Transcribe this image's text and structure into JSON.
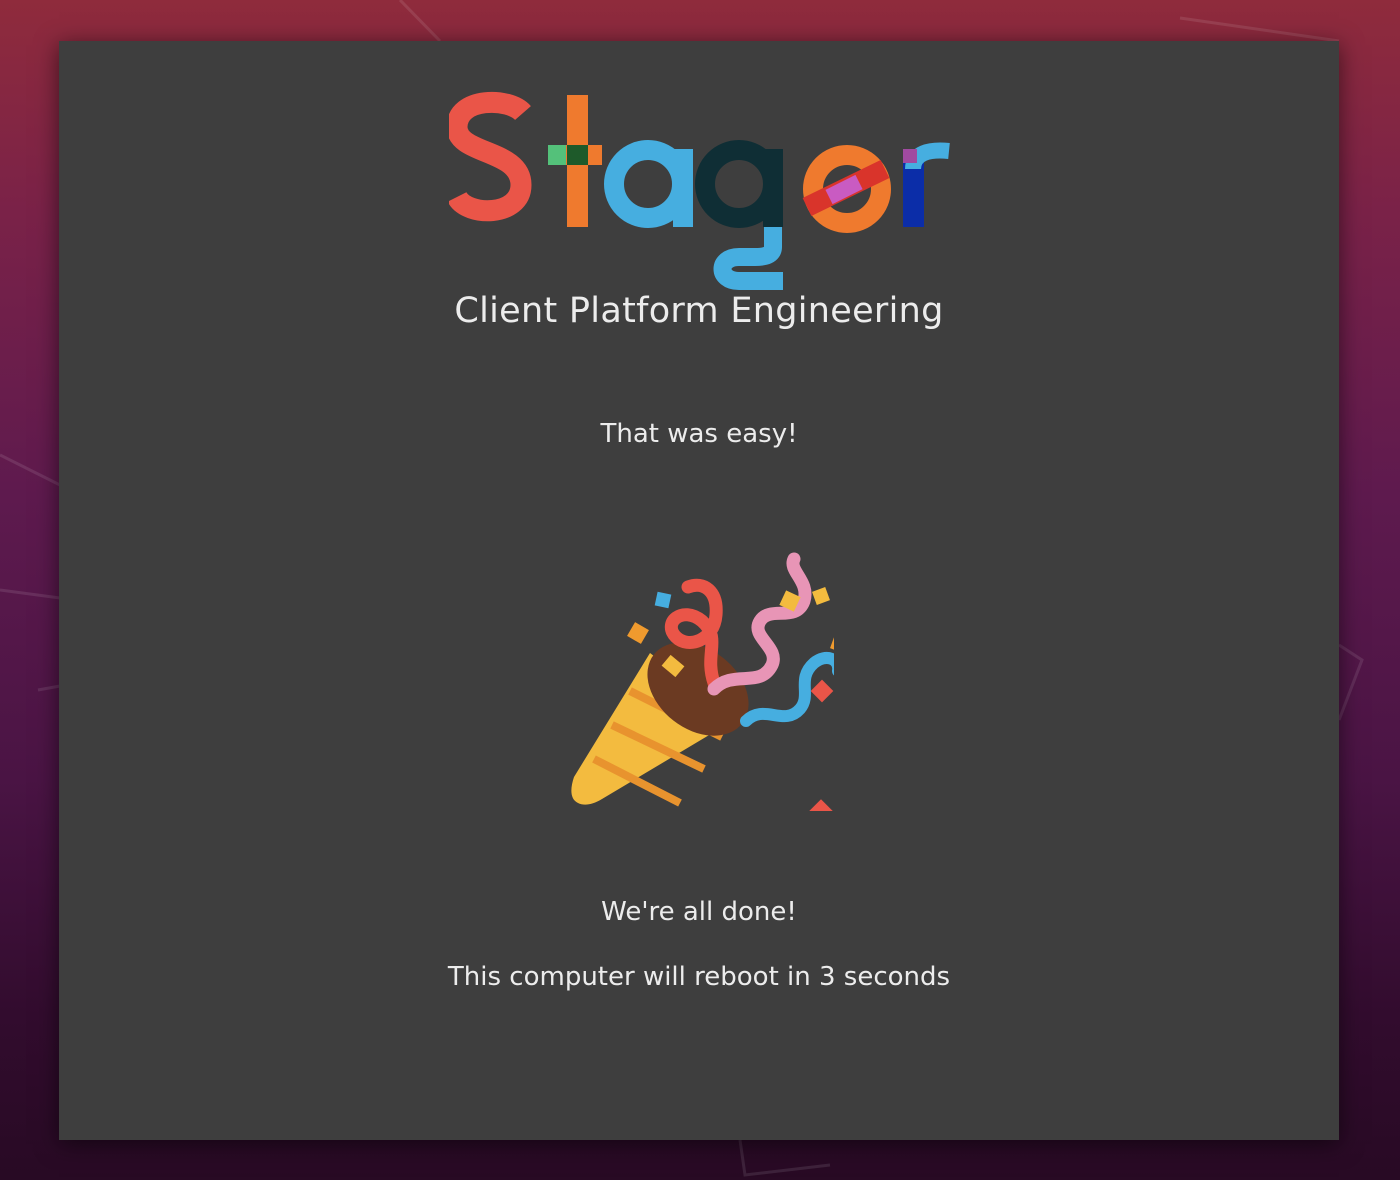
{
  "logo": {
    "text": "Stager",
    "colors": {
      "s": "#ea5548",
      "t": "#ef7a2e",
      "t_accent": "#54c17a",
      "a": "#46aee0",
      "g_dark": "#0f2e35",
      "g_blue": "#46aee0",
      "e": "#ef7a2e",
      "e_band": "#d9342b",
      "e_pink": "#c95bc2",
      "r": "#0b2da8",
      "r_accent": "#46aee0",
      "r_purple": "#a04aa0"
    }
  },
  "subtitle": "Client Platform Engineering",
  "messages": {
    "easy": "That was easy!",
    "done": "We're all done!",
    "reboot": "This computer will reboot in 3 seconds"
  },
  "icons": {
    "celebration": "party-popper-icon"
  },
  "colors": {
    "window_bg": "#3e3e3e",
    "text": "#ececec"
  }
}
